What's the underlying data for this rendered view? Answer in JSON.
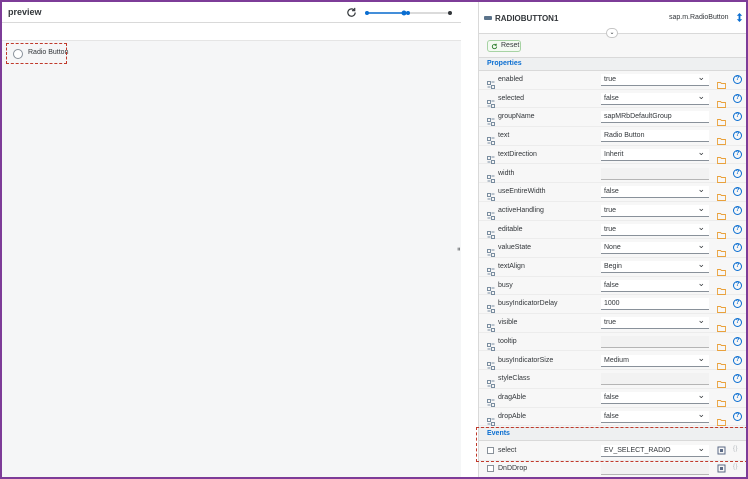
{
  "preview": {
    "title": "preview",
    "zoom_level": 0.4,
    "radio_label": "Radio Button"
  },
  "panel": {
    "control_name": "RADIOBUTTON1",
    "control_class": "sap.m.RadioButton",
    "reset_label": "Reset",
    "properties_header": "Properties",
    "events_header": "Events",
    "properties": [
      {
        "label": "enabled",
        "value": "true",
        "kind": "select"
      },
      {
        "label": "selected",
        "value": "false",
        "kind": "select"
      },
      {
        "label": "groupName",
        "value": "sapMRbDefaultGroup",
        "kind": "input"
      },
      {
        "label": "text",
        "value": "Radio Button",
        "kind": "input"
      },
      {
        "label": "textDirection",
        "value": "Inherit",
        "kind": "select"
      },
      {
        "label": "width",
        "value": "",
        "kind": "empty"
      },
      {
        "label": "useEntireWidth",
        "value": "false",
        "kind": "select"
      },
      {
        "label": "activeHandling",
        "value": "true",
        "kind": "select"
      },
      {
        "label": "editable",
        "value": "true",
        "kind": "select"
      },
      {
        "label": "valueState",
        "value": "None",
        "kind": "select"
      },
      {
        "label": "textAlign",
        "value": "Begin",
        "kind": "select"
      },
      {
        "label": "busy",
        "value": "false",
        "kind": "select"
      },
      {
        "label": "busyIndicatorDelay",
        "value": "1000",
        "kind": "input"
      },
      {
        "label": "visible",
        "value": "true",
        "kind": "select"
      },
      {
        "label": "tooltip",
        "value": "",
        "kind": "empty"
      },
      {
        "label": "busyIndicatorSize",
        "value": "Medium",
        "kind": "select"
      },
      {
        "label": "styleClass",
        "value": "",
        "kind": "empty"
      },
      {
        "label": "dragAble",
        "value": "false",
        "kind": "select"
      },
      {
        "label": "dropAble",
        "value": "false",
        "kind": "select"
      }
    ],
    "events": [
      {
        "label": "select",
        "value": "EV_SELECT_RADIO",
        "kind": "select"
      },
      {
        "label": "DnDDrop",
        "value": "",
        "kind": "empty"
      }
    ]
  },
  "colors": {
    "frame": "#7d3c98",
    "highlight": "#c0392b",
    "accent": "#0a6ed1",
    "bind_icon": "#e9a13b"
  }
}
